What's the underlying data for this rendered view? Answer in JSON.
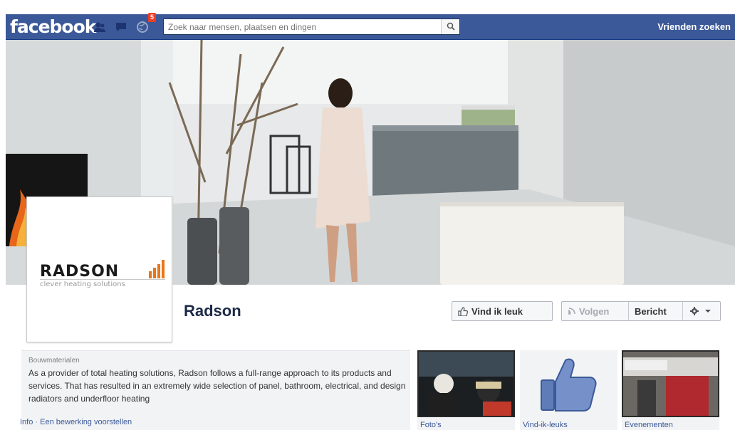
{
  "header": {
    "logo": "facebook",
    "notification_count": "5",
    "search_placeholder": "Zoek naar mensen, plaatsen en dingen",
    "find_friends": "Vrienden zoeken"
  },
  "profile_picture": {
    "brand": "RADSON",
    "tagline": "clever heating solutions"
  },
  "page": {
    "name": "Radson",
    "like_button": "Vind ik leuk",
    "follow_button": "Volgen",
    "message_button": "Bericht"
  },
  "about": {
    "category": "Bouwmaterialen",
    "description": "As a provider of total heating solutions, Radson follows a full-range approach to its products and services. That has resulted in an extremely wide selection of panel, bathroom, electrical, and design radiators and underfloor heating",
    "link_info": "Info",
    "link_separator": "·",
    "link_suggest": "Een bewerking voorstellen"
  },
  "apps": [
    {
      "label": "Foto's"
    },
    {
      "label": "Vind-ik-leuks"
    },
    {
      "label": "Evenementen"
    }
  ],
  "colors": {
    "facebook_blue": "#3b5998",
    "brand_orange": "#e8761a",
    "badge_red": "#f03d25"
  },
  "icons": [
    "friend-requests-icon",
    "messages-icon",
    "notifications-icon",
    "search-icon",
    "thumbs-up-icon",
    "gear-icon",
    "chevron-down-icon"
  ]
}
